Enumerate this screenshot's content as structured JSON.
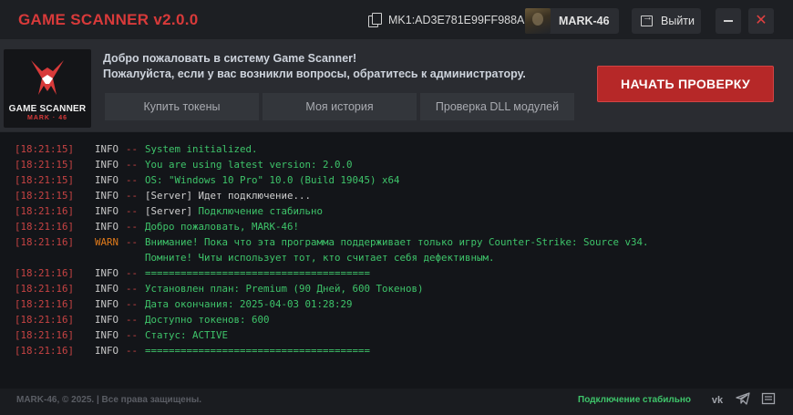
{
  "app": {
    "title": "GAME SCANNER v2.0.0",
    "machine_id": "MK1:AD3E781E99FF988A",
    "user_name": "MARK-46",
    "logout_label": "Выйти",
    "close_glyph": "✕"
  },
  "logo": {
    "title": "GAME SCANNER",
    "subtitle": "MARK · 46"
  },
  "header": {
    "welcome_line1": "Добро пожаловать в систему Game Scanner!",
    "welcome_line2": "Пожалуйста, если у вас возникли вопросы, обратитесь к администратору.",
    "nav": [
      {
        "label": "Купить токены"
      },
      {
        "label": "Моя история"
      },
      {
        "label": "Проверка DLL модулей"
      }
    ],
    "start_label": "НАЧАТЬ ПРОВЕРКУ"
  },
  "log": {
    "separator": "--",
    "entries": [
      {
        "time": "[18:21:15]",
        "level": "INFO",
        "message": "System initialized."
      },
      {
        "time": "[18:21:15]",
        "level": "INFO",
        "message": "You are using latest version: 2.0.0"
      },
      {
        "time": "[18:21:15]",
        "level": "INFO",
        "message": "OS: \"Windows 10 Pro\" 10.0 (Build 19045) x64"
      },
      {
        "time": "[18:21:15]",
        "level": "INFO",
        "message": "[Server] Идет подключение..."
      },
      {
        "time": "[18:21:16]",
        "level": "INFO",
        "message": "[Server] Подключение стабильно"
      },
      {
        "time": "[18:21:16]",
        "level": "INFO",
        "message": "Добро пожаловать, MARK-46!"
      },
      {
        "time": "[18:21:16]",
        "level": "WARN",
        "message": "Внимание! Пока что эта программа поддерживает только игру Counter-Strike: Source v34."
      },
      {
        "time": "",
        "level": "",
        "message": "Помните! Читы использует тот, кто считает себя дефективным."
      },
      {
        "time": "[18:21:16]",
        "level": "INFO",
        "message": "======================================"
      },
      {
        "time": "[18:21:16]",
        "level": "INFO",
        "message": "Установлен план: Premium (90 Дней, 600 Токенов)"
      },
      {
        "time": "[18:21:16]",
        "level": "INFO",
        "message": "Дата окончания: 2025-04-03 01:28:29"
      },
      {
        "time": "[18:21:16]",
        "level": "INFO",
        "message": "Доступно токенов: 600"
      },
      {
        "time": "[18:21:16]",
        "level": "INFO",
        "message": "Статус: ACTIVE"
      },
      {
        "time": "[18:21:16]",
        "level": "INFO",
        "message": "======================================"
      }
    ]
  },
  "footer": {
    "copyright": "MARK-46, © 2025. | Все права защищены.",
    "status": "Подключение стабильно",
    "icons": [
      "vk-icon",
      "telegram-icon",
      "chat-icon"
    ],
    "vk_glyph": "vk"
  },
  "colors": {
    "accent_red": "#d83a3a",
    "button_red": "#b62828",
    "success_green": "#3ec46a",
    "warn_orange": "#e07a1a"
  }
}
